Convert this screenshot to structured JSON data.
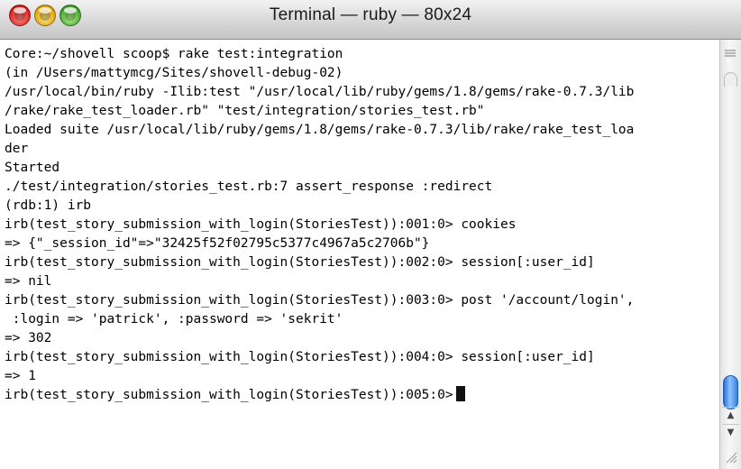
{
  "window": {
    "title": "Terminal — ruby — 80x24"
  },
  "terminal": {
    "lines": [
      "Core:~/shovell scoop$ rake test:integration",
      "(in /Users/mattymcg/Sites/shovell-debug-02)",
      "/usr/local/bin/ruby -Ilib:test \"/usr/local/lib/ruby/gems/1.8/gems/rake-0.7.3/lib",
      "/rake/rake_test_loader.rb\" \"test/integration/stories_test.rb\"",
      "Loaded suite /usr/local/lib/ruby/gems/1.8/gems/rake-0.7.3/lib/rake/rake_test_loa",
      "der",
      "Started",
      "./test/integration/stories_test.rb:7 assert_response :redirect",
      "(rdb:1) irb",
      "irb(test_story_submission_with_login(StoriesTest)):001:0> cookies",
      "=> {\"_session_id\"=>\"32425f52f02795c5377c4967a5c2706b\"}",
      "irb(test_story_submission_with_login(StoriesTest)):002:0> session[:user_id]",
      "=> nil",
      "irb(test_story_submission_with_login(StoriesTest)):003:0> post '/account/login',",
      " :login => 'patrick', :password => 'sekrit'",
      "=> 302",
      "irb(test_story_submission_with_login(StoriesTest)):004:0> session[:user_id]",
      "=> 1",
      "irb(test_story_submission_with_login(StoriesTest)):005:0>"
    ]
  },
  "icons": {
    "close": "close-icon",
    "minimize": "minimize-icon",
    "zoom": "zoom-icon",
    "split": "split-pane-icon",
    "scroll_up": "arrow-up-icon",
    "scroll_down": "arrow-down-icon",
    "resize": "resize-grip-icon"
  },
  "colors": {
    "close": "#d81b1b",
    "minimize": "#e0a000",
    "zoom": "#3da12b",
    "scroll_thumb": "#3b7fe0",
    "text": "#000000",
    "background": "#ffffff"
  }
}
